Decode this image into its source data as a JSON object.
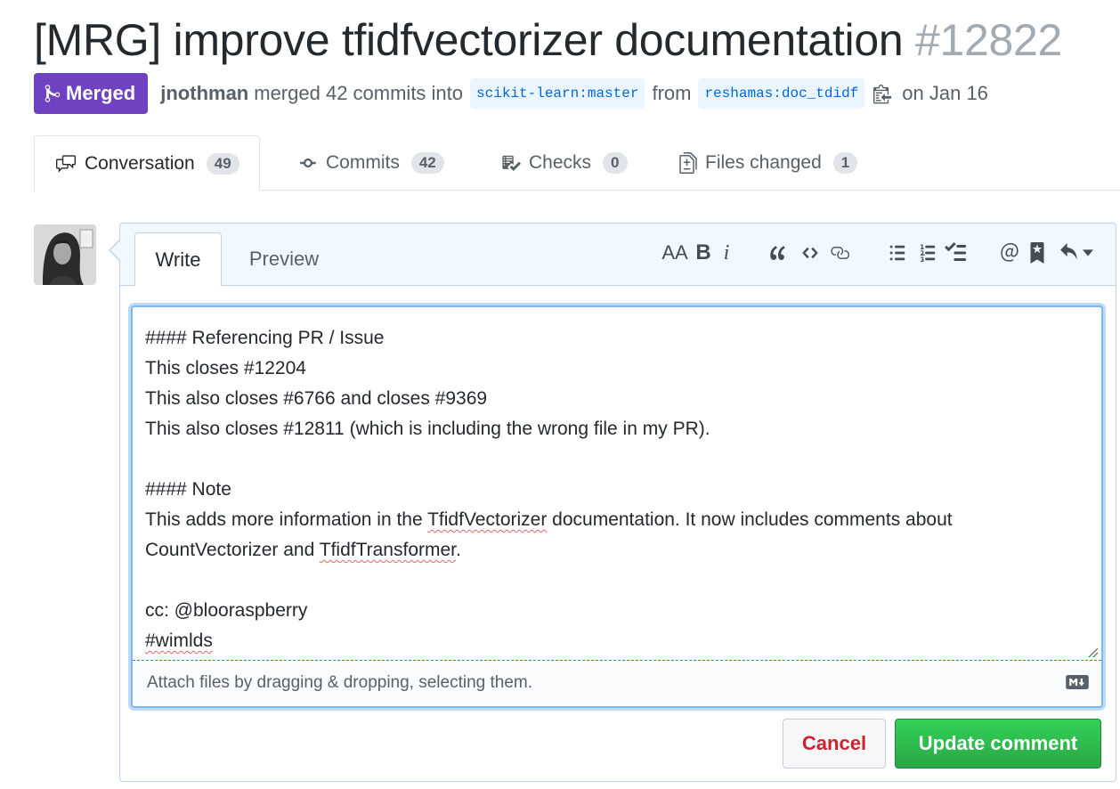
{
  "pr": {
    "title": "[MRG] improve tfidfvectorizer documentation",
    "number": "#12822",
    "state": "Merged",
    "author": "jnothman",
    "action": "merged 42 commits into",
    "base_branch": "scikit-learn:master",
    "from_text": "from",
    "head_branch": "reshamas:doc_tdidf",
    "date_text": "on Jan 16"
  },
  "tabs": [
    {
      "label": "Conversation",
      "count": "49",
      "icon": "comment-discussion-icon"
    },
    {
      "label": "Commits",
      "count": "42",
      "icon": "git-commit-icon"
    },
    {
      "label": "Checks",
      "count": "0",
      "icon": "checklist-icon"
    },
    {
      "label": "Files changed",
      "count": "1",
      "icon": "diff-icon"
    }
  ],
  "editor": {
    "write_tab": "Write",
    "preview_tab": "Preview",
    "toolbar": {
      "header": "AA",
      "bold": "B",
      "italic": "i"
    },
    "lines": [
      "#### Referencing PR / Issue",
      "This closes #12204",
      "This also closes #6766 and closes #9369",
      "This also closes #12811 (which is including the wrong file in my PR).",
      "",
      "#### Note",
      "This adds more information in the TfidfVectorizer documentation. It now includes comments about",
      "CountVectorizer and TfidfTransformer.",
      "",
      "cc: @blooraspberry",
      "#wimlds"
    ],
    "attach_text": "Attach files by dragging & dropping, selecting them.",
    "cancel_label": "Cancel",
    "update_label": "Update comment"
  },
  "colors": {
    "merged": "#6f42c1",
    "link": "#0366d6",
    "cancel": "#cb2431",
    "update": "#28a745"
  }
}
